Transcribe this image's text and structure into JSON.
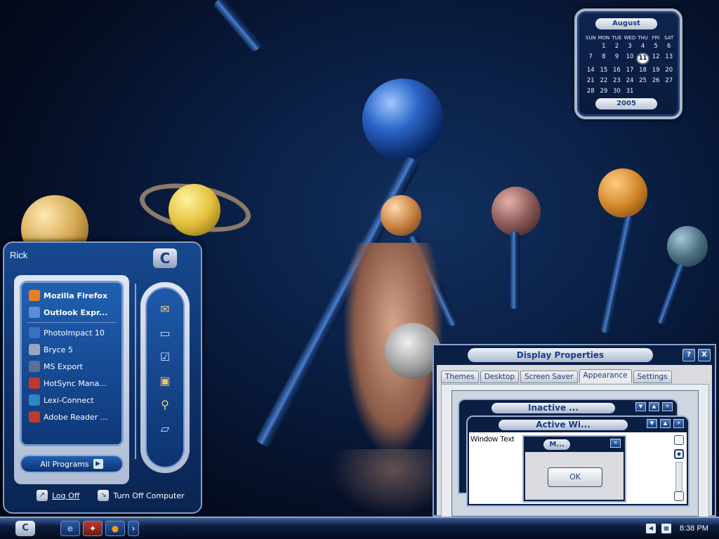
{
  "calendar": {
    "month": "August",
    "year": "2005",
    "weekdays": [
      "SUN",
      "MON",
      "TUE",
      "WED",
      "THU",
      "FRI",
      "SAT"
    ],
    "weeks": [
      [
        "",
        "1",
        "2",
        "3",
        "4",
        "5",
        "6"
      ],
      [
        "7",
        "8",
        "9",
        "10",
        "11",
        "12",
        "13"
      ],
      [
        "14",
        "15",
        "16",
        "17",
        "18",
        "19",
        "20"
      ],
      [
        "21",
        "22",
        "23",
        "24",
        "25",
        "26",
        "27"
      ],
      [
        "28",
        "29",
        "30",
        "31",
        "",
        "",
        ""
      ]
    ],
    "today": "11"
  },
  "start_menu": {
    "user": "Rick",
    "logo": "C",
    "pinned": [
      {
        "label": "Mozilla Firefox",
        "icon": "firefox-icon",
        "color": "#e67e22"
      },
      {
        "label": "Outlook Expr...",
        "icon": "outlook-express-icon",
        "color": "#5a8fd8"
      }
    ],
    "recent": [
      {
        "label": "PhotoImpact 10",
        "icon": "photoimpact-icon",
        "color": "#3a6fc2"
      },
      {
        "label": "Bryce 5",
        "icon": "bryce-icon",
        "color": "#9aa7bd"
      },
      {
        "label": "MS Export",
        "icon": "ms-export-icon",
        "color": "#5a6f93"
      },
      {
        "label": "HotSync Mana...",
        "icon": "hotsync-icon",
        "color": "#c0392b"
      },
      {
        "label": "Lexi-Connect",
        "icon": "lexi-connect-icon",
        "color": "#2e86c1"
      },
      {
        "label": "Adobe Reader ...",
        "icon": "adobe-reader-icon",
        "color": "#c0392b"
      }
    ],
    "all_programs": "All Programs",
    "right_icons": [
      "my-documents-icon",
      "my-computer-icon",
      "control-panel-icon",
      "network-icon",
      "search-icon",
      "run-icon"
    ],
    "logoff": "Log Off",
    "turnoff": "Turn Off Computer"
  },
  "display_properties": {
    "title": "Display Properties",
    "help_btn": "?",
    "close_btn": "X",
    "tabs": [
      "Themes",
      "Desktop",
      "Screen Saver",
      "Appearance",
      "Settings"
    ],
    "active_tab": "Appearance",
    "preview": {
      "inactive_title": "Inactive ...",
      "active_title": "Active Wi...",
      "window_text": "Window Text",
      "msg_title": "M...",
      "ok_label": "OK"
    }
  },
  "taskbar": {
    "start_label": "C",
    "quick_launch": [
      "internet-explorer-icon",
      "app-icon",
      "firefox-icon",
      "show-more-icon"
    ],
    "time": "8:38 PM"
  }
}
